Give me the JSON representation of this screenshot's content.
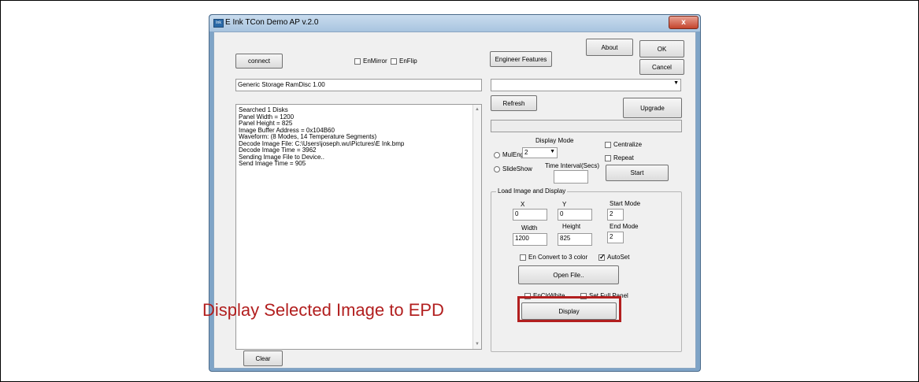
{
  "window": {
    "title": "E Ink TCon Demo AP v.2.0",
    "icon_text": "Ink",
    "close_glyph": "x"
  },
  "top": {
    "connect_label": "connect",
    "enmirror_label": "EnMirror",
    "enflip_label": "EnFlip",
    "engineer_label": "Engineer Features",
    "about_label": "About",
    "ok_label": "OK",
    "cancel_label": "Cancel"
  },
  "device_field_value": "Generic Storage RamDisc 1.00",
  "device_combo_value": "",
  "refresh_label": "Refresh",
  "upgrade_label": "Upgrade",
  "log_lines": [
    "Searched 1 Disks",
    "Panel Width = 1200",
    "Panel Height = 825",
    "Image Buffer Address = 0x104B60",
    "Waveform: (8 Modes, 14 Temperature Segments)",
    "Decode Image File: C:\\Users\\joseph.wu\\Pictures\\E Ink.bmp",
    "Decode Image Time = 3962",
    "Sending Image File to Device..",
    "Send Image Time = 905"
  ],
  "clear_label": "Clear",
  "display_mode": {
    "label": "Display Mode",
    "value": "2",
    "mulengine_label": "MulEngine",
    "slideshow_label": "SlideShow",
    "time_interval_label": "Time Interval(Secs)",
    "time_interval_value": "",
    "centralize_label": "Centralize",
    "repeat_label": "Repeat",
    "start_label": "Start"
  },
  "load_image": {
    "group_label": "Load Image and Display",
    "x_label": "X",
    "y_label": "Y",
    "start_mode_label": "Start Mode",
    "x_value": "0",
    "y_value": "0",
    "start_mode_value": "2",
    "width_label": "Width",
    "height_label": "Height",
    "end_mode_label": "End Mode",
    "width_value": "1200",
    "height_value": "825",
    "end_mode_value": "2",
    "convert_label": "En Convert to 3 color",
    "autoset_label": "AutoSet",
    "open_file_label": "Open File..",
    "enclrwhite_label": "EnClrWhite",
    "full_panel_label": "Set Full Panel",
    "display_label": "Display"
  },
  "annotation": {
    "text": "Display Selected Image to EPD",
    "color": "#b21f1f"
  },
  "colors": {
    "titlebar": "#a8c4df",
    "client_bg": "#f0f0f0",
    "close_button": "#c4442c"
  }
}
